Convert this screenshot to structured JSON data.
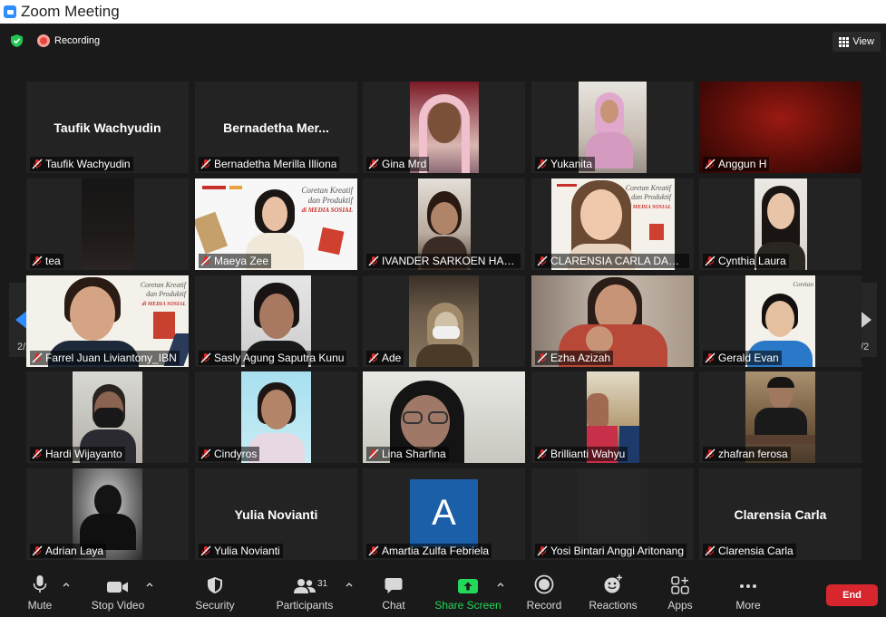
{
  "window": {
    "title": "Zoom Meeting"
  },
  "status": {
    "recording_label": "Recording",
    "view_label": "View"
  },
  "pagination": {
    "left_page": "2/2",
    "right_page": "2/2"
  },
  "participants": [
    {
      "name": "Taufik Wachyudin",
      "center_name": "Taufik Wachyudin",
      "video": false
    },
    {
      "name": "Bernadetha Merilla Illiona",
      "center_name": "Bernadetha  Mer...",
      "video": false
    },
    {
      "name": "Gina Mrd",
      "video": true
    },
    {
      "name": "Yukanita",
      "video": true
    },
    {
      "name": "Anggun H",
      "video": true
    },
    {
      "name": "tea",
      "video": true
    },
    {
      "name": "Maeya Zee",
      "video": true
    },
    {
      "name": "IVANDER SARKOEN HAMIJ...",
      "video": true
    },
    {
      "name": "CLARENSIA CARLA DARA D...",
      "video": true
    },
    {
      "name": "Cynthia Laura",
      "video": true
    },
    {
      "name": "Farrel Juan Liviantony_IBN",
      "video": true
    },
    {
      "name": "Sasly Agung Saputra Kunu",
      "video": true
    },
    {
      "name": "Ade",
      "video": true
    },
    {
      "name": "Ezha Azizah",
      "video": true
    },
    {
      "name": "Gerald Evan",
      "video": true
    },
    {
      "name": "Hardi Wijayanto",
      "video": true
    },
    {
      "name": "Cindyros",
      "video": true
    },
    {
      "name": "Lina Sharfina",
      "video": true
    },
    {
      "name": "Brillianti Wahyu",
      "video": true
    },
    {
      "name": "zhafran ferosa",
      "video": true
    },
    {
      "name": "Adrian Laya",
      "video": true
    },
    {
      "name": "Yulia Novianti",
      "center_name": "Yulia Novianti",
      "video": false
    },
    {
      "name": "Amartia Zulfa Febriela",
      "avatar_letter": "A",
      "video": false
    },
    {
      "name": "Yosi Bintari Anggi Aritonang",
      "video": true
    },
    {
      "name": "Clarensia Carla",
      "center_name": "Clarensia Carla",
      "video": false
    }
  ],
  "slide_text": {
    "line1": "Coretan Kreatif",
    "line2": "dan Produktif",
    "line3": "di MEDIA SOSIAL"
  },
  "toolbar": {
    "mute": "Mute",
    "stop_video": "Stop Video",
    "security": "Security",
    "participants": "Participants",
    "participants_count": "31",
    "chat": "Chat",
    "share_screen": "Share Screen",
    "record": "Record",
    "reactions": "Reactions",
    "apps": "Apps",
    "more": "More",
    "end": "End"
  },
  "colors": {
    "accent": "#2d8cff",
    "share_green": "#23d959",
    "end_red": "#d7262d",
    "recording_red": "#e8453c",
    "muted_mic_red": "#e02828"
  }
}
